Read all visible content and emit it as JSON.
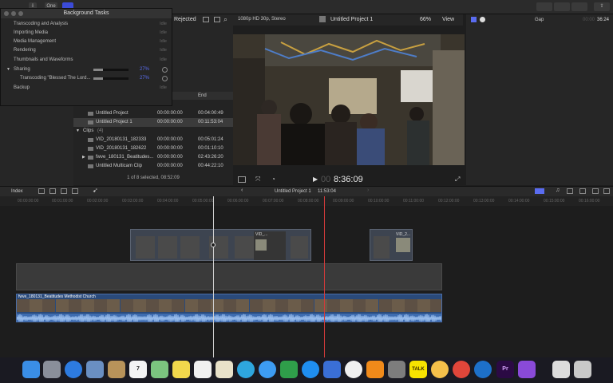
{
  "background_tasks": {
    "title": "Background Tasks",
    "tasks": [
      {
        "label": "Transcoding and Analysis",
        "status": "Idle"
      },
      {
        "label": "Importing Media",
        "status": "Idle"
      },
      {
        "label": "Media Management",
        "status": "Idle"
      },
      {
        "label": "Rendering",
        "status": "Idle"
      },
      {
        "label": "Thumbnails and Waveforms",
        "status": "Idle"
      },
      {
        "label": "Sharing",
        "percent": "27%",
        "progress": 0.27
      },
      {
        "label": "Transcoding \"Blessed The Lord...",
        "percent": "27%",
        "progress": 0.27
      },
      {
        "label": "Backup",
        "status": "Idle"
      }
    ]
  },
  "browser": {
    "filter": "Rejected",
    "end_label": "End",
    "rows": [
      {
        "name": "Untitled Project",
        "start": "00:00:00:00",
        "duration": "00:04:00:49"
      },
      {
        "name": "Untitled Project 1",
        "start": "00:00:00:00",
        "duration": "00:11:53:04",
        "selected": true
      },
      {
        "name": "Clips",
        "count": "(4)"
      },
      {
        "name": "VID_20180131_182333",
        "start": "00:00:00:00",
        "duration": "00:05:01:24"
      },
      {
        "name": "VID_20180131_182622",
        "start": "00:00:00:00",
        "duration": "00:01:10:10"
      },
      {
        "name": "fwve_180131_Beatitudes...",
        "start": "00:00:00:00",
        "duration": "02:43:26:20"
      },
      {
        "name": "Untitled Multicam Clip",
        "start": "00:00:00:00",
        "duration": "00:44:22:10"
      }
    ],
    "footer": "1 of 8 selected, 08:52:09"
  },
  "viewer": {
    "format": "1080p HD 30p, Stereo",
    "title": "Untitled Project 1",
    "zoom": "66%",
    "view_label": "View",
    "timecode_dim": "00",
    "timecode": "8:36:09"
  },
  "inspector": {
    "label": "Gap",
    "time_dim": "00:00",
    "time": "36:24"
  },
  "timeline": {
    "index_label": "Index",
    "project": "Untitled Project 1",
    "duration": "11:53:04",
    "ticks": [
      "00:00:00:00",
      "00:01:00:00",
      "00:02:00:00",
      "00:03:00:00",
      "00:04:00:00",
      "00:05:00:00",
      "00:06:00:00",
      "00:07:00:00",
      "00:08:00:00",
      "00:09:00:00",
      "00:10:00:00",
      "00:11:00:00",
      "00:12:00:00",
      "00:13:00:00",
      "00:14:00:00",
      "00:15:00:00",
      "00:16:00:00"
    ],
    "clip_label_1": "VID_...",
    "clip_label_2": "VID_2...",
    "primary_label": "fwve_180131_Beatitudes Methodist Church"
  },
  "toolbar": {
    "one_label": "One"
  },
  "dock": {
    "items": [
      "finder-icon",
      "launchpad-icon",
      "safari-icon",
      "preview-icon",
      "notes-icon",
      "calendar-icon",
      "maps-icon",
      "stickies-icon",
      "reminders-icon",
      "textedit-icon",
      "telegram-icon",
      "messages-icon",
      "numbers-icon",
      "appstore-icon",
      "keynote-icon",
      "music-icon",
      "books-icon",
      "systemprefs-icon",
      "kakaotalk-icon",
      "photos-icon",
      "chrome-icon",
      "teamviewer-icon",
      "premiere-icon",
      "finalcut-icon",
      "document-icon",
      "trash-icon"
    ],
    "calendar_day": "7",
    "talk_label": "TALK",
    "pr_label": "Pr"
  },
  "colors": {
    "accent": "#5a6cf0",
    "primary_clip": "#2a4a7a",
    "playhead": "#d0d0d0",
    "skimmer": "#d13a3a"
  }
}
